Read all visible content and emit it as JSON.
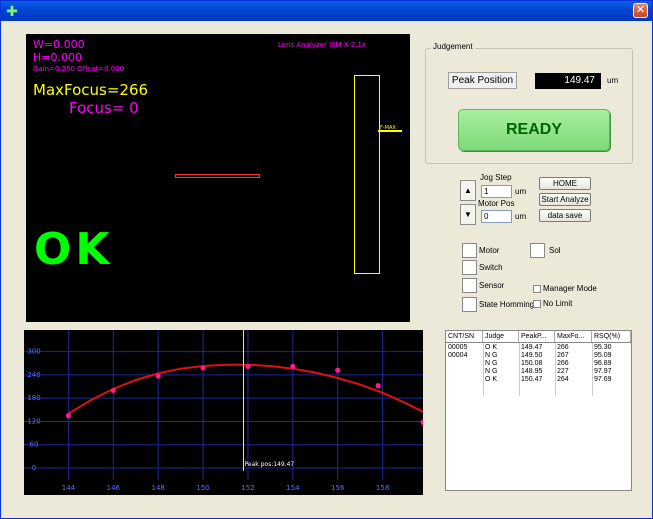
{
  "window": {
    "app_icon": "green-cross-icon",
    "close_label": "✕"
  },
  "monitor": {
    "w_text": "W=0.000",
    "h_text": "H=0.000",
    "gain_text": "Gain=0.250 Offset=0.000",
    "analyzer_text": "Lens Analyzer ISM X-2.1x",
    "maxfocus_text": "MaxFocus=266",
    "focus_text": "Focus=  0",
    "ok_text": "OK",
    "fmax_text": "F-MAX",
    "colors": {
      "magenta": "#ff00ff",
      "yellow": "#ffff00",
      "green": "#00ff00",
      "red": "#ff3333"
    }
  },
  "judgement": {
    "group_label": "Judgement",
    "peak_label": "Peak Position",
    "peak_value": "149.47",
    "peak_unit": "um",
    "ready_label": "READY"
  },
  "jog": {
    "up_label": "▲",
    "down_label": "▼",
    "step_label": "Jog Step",
    "step_value": "1",
    "step_unit": "um",
    "motor_label": "Motor Pos",
    "motor_value": "0",
    "motor_unit": "um",
    "home_label": "HOME",
    "start_label": "Start Analyze",
    "save_label": "data save"
  },
  "status": {
    "motor": "Motor",
    "switch": "Switch",
    "sensor": "Sensor",
    "homming": "State Homming",
    "sol": "Sol",
    "manager": "Manager Mode",
    "nolimit": "No Limit"
  },
  "chart_data": {
    "type": "line",
    "x_ticks": [
      "144",
      "146",
      "148",
      "150",
      "152",
      "154",
      "156",
      "158"
    ],
    "y_ticks": [
      "0",
      "60",
      "120",
      "180",
      "240",
      "300"
    ],
    "ylim": [
      0,
      330
    ],
    "xlim": [
      143.0,
      159.8
    ],
    "points": {
      "x": [
        144,
        146,
        148,
        150,
        152,
        154,
        156,
        157.8,
        159.8
      ],
      "y": [
        135,
        200,
        237,
        258,
        262,
        262,
        252,
        212,
        118
      ]
    },
    "fit_curve": {
      "x": [
        144,
        145,
        146,
        147,
        148,
        149,
        150,
        151,
        152,
        153,
        154,
        155,
        156,
        157,
        158,
        159,
        159.8
      ],
      "y": [
        140,
        175,
        204,
        227,
        244,
        256,
        263,
        266,
        266,
        263,
        256,
        246,
        232,
        215,
        194,
        168,
        145
      ]
    },
    "peak_x": 151.8,
    "peak_label": "Peak pos:149.47",
    "colors": {
      "curve": "#e01010",
      "points": "#ff1a8c",
      "peak": "#ffff00",
      "grid": "#1a2a9a",
      "tick": "#5070ff"
    }
  },
  "table": {
    "headers": [
      "CNT/SN",
      "Judge",
      "PeakP...",
      "MaxFo...",
      "RSQ(%)"
    ],
    "rows": [
      [
        "00005",
        "O K",
        "149.47",
        "266",
        "95.30"
      ],
      [
        "00004",
        "N G",
        "149.50",
        "267",
        "95.09"
      ],
      [
        "",
        "N G",
        "150.08",
        "266",
        "96.89"
      ],
      [
        "",
        "N G",
        "148.95",
        "227",
        "97.97"
      ],
      [
        "",
        "O K",
        "150.47",
        "264",
        "97.69"
      ]
    ]
  }
}
